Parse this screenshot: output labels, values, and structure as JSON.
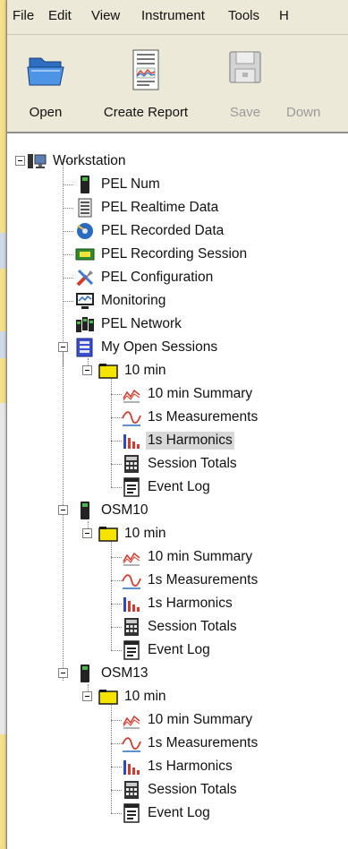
{
  "menu": {
    "items": [
      "File",
      "Edit",
      "View",
      "Instrument",
      "Tools",
      "H"
    ]
  },
  "toolbar": {
    "open_label": "Open",
    "create_report_label": "Create Report",
    "save_label": "Save",
    "download_label": "Down"
  },
  "tree": {
    "workstation": "Workstation",
    "pel_num": "PEL Num",
    "pel_realtime": "PEL Realtime Data",
    "pel_recorded": "PEL Recorded Data",
    "pel_recording_session": "PEL Recording Session",
    "pel_configuration": "PEL Configuration",
    "monitoring": "Monitoring",
    "pel_network": "PEL Network",
    "my_open_sessions": "My Open Sessions",
    "osm10": "OSM10",
    "osm13": "OSM13",
    "session_label": "10 min",
    "summary_label": "10 min Summary",
    "measurements_label": "1s Measurements",
    "harmonics_label": "1s Harmonics",
    "totals_label": "Session Totals",
    "event_log_label": "Event Log"
  },
  "colors": {
    "selection": "#d8d8d8",
    "toolbar_bg": "#ece9d8",
    "folder_yellow": "#f5e400"
  }
}
